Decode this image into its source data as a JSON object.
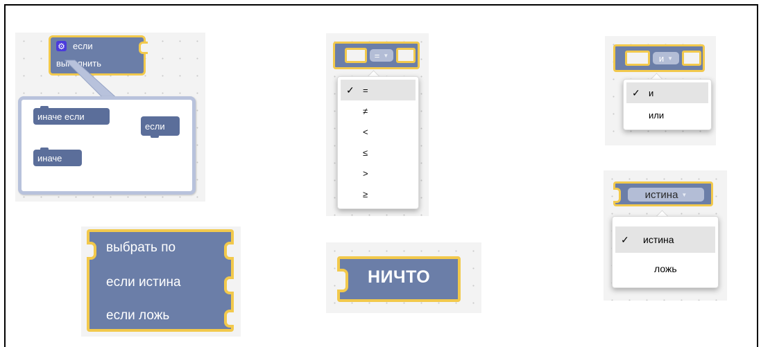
{
  "if_block": {
    "label_if": "если",
    "label_do": "выполнить",
    "gear_icon": "gear-icon",
    "mutator": {
      "items": [
        "иначе если",
        "иначе"
      ],
      "container_label": "если"
    }
  },
  "compare_block": {
    "selected": "=",
    "options": [
      "=",
      "≠",
      "<",
      "≤",
      ">",
      "≥"
    ],
    "selected_index": 0
  },
  "logic_op_block": {
    "selected": "и",
    "options": [
      "и",
      "или"
    ],
    "selected_index": 0
  },
  "boolean_block": {
    "selected": "истина",
    "options": [
      "истина",
      "ложь"
    ],
    "selected_index": 0
  },
  "ternary_block": {
    "lines": [
      "выбрать по",
      "если истина",
      "если ложь"
    ]
  },
  "null_block": {
    "label": "НИЧТО"
  },
  "colors": {
    "block": "#6b7ea8",
    "outline": "#f2c94c",
    "workspace": "#f3f3f3"
  }
}
